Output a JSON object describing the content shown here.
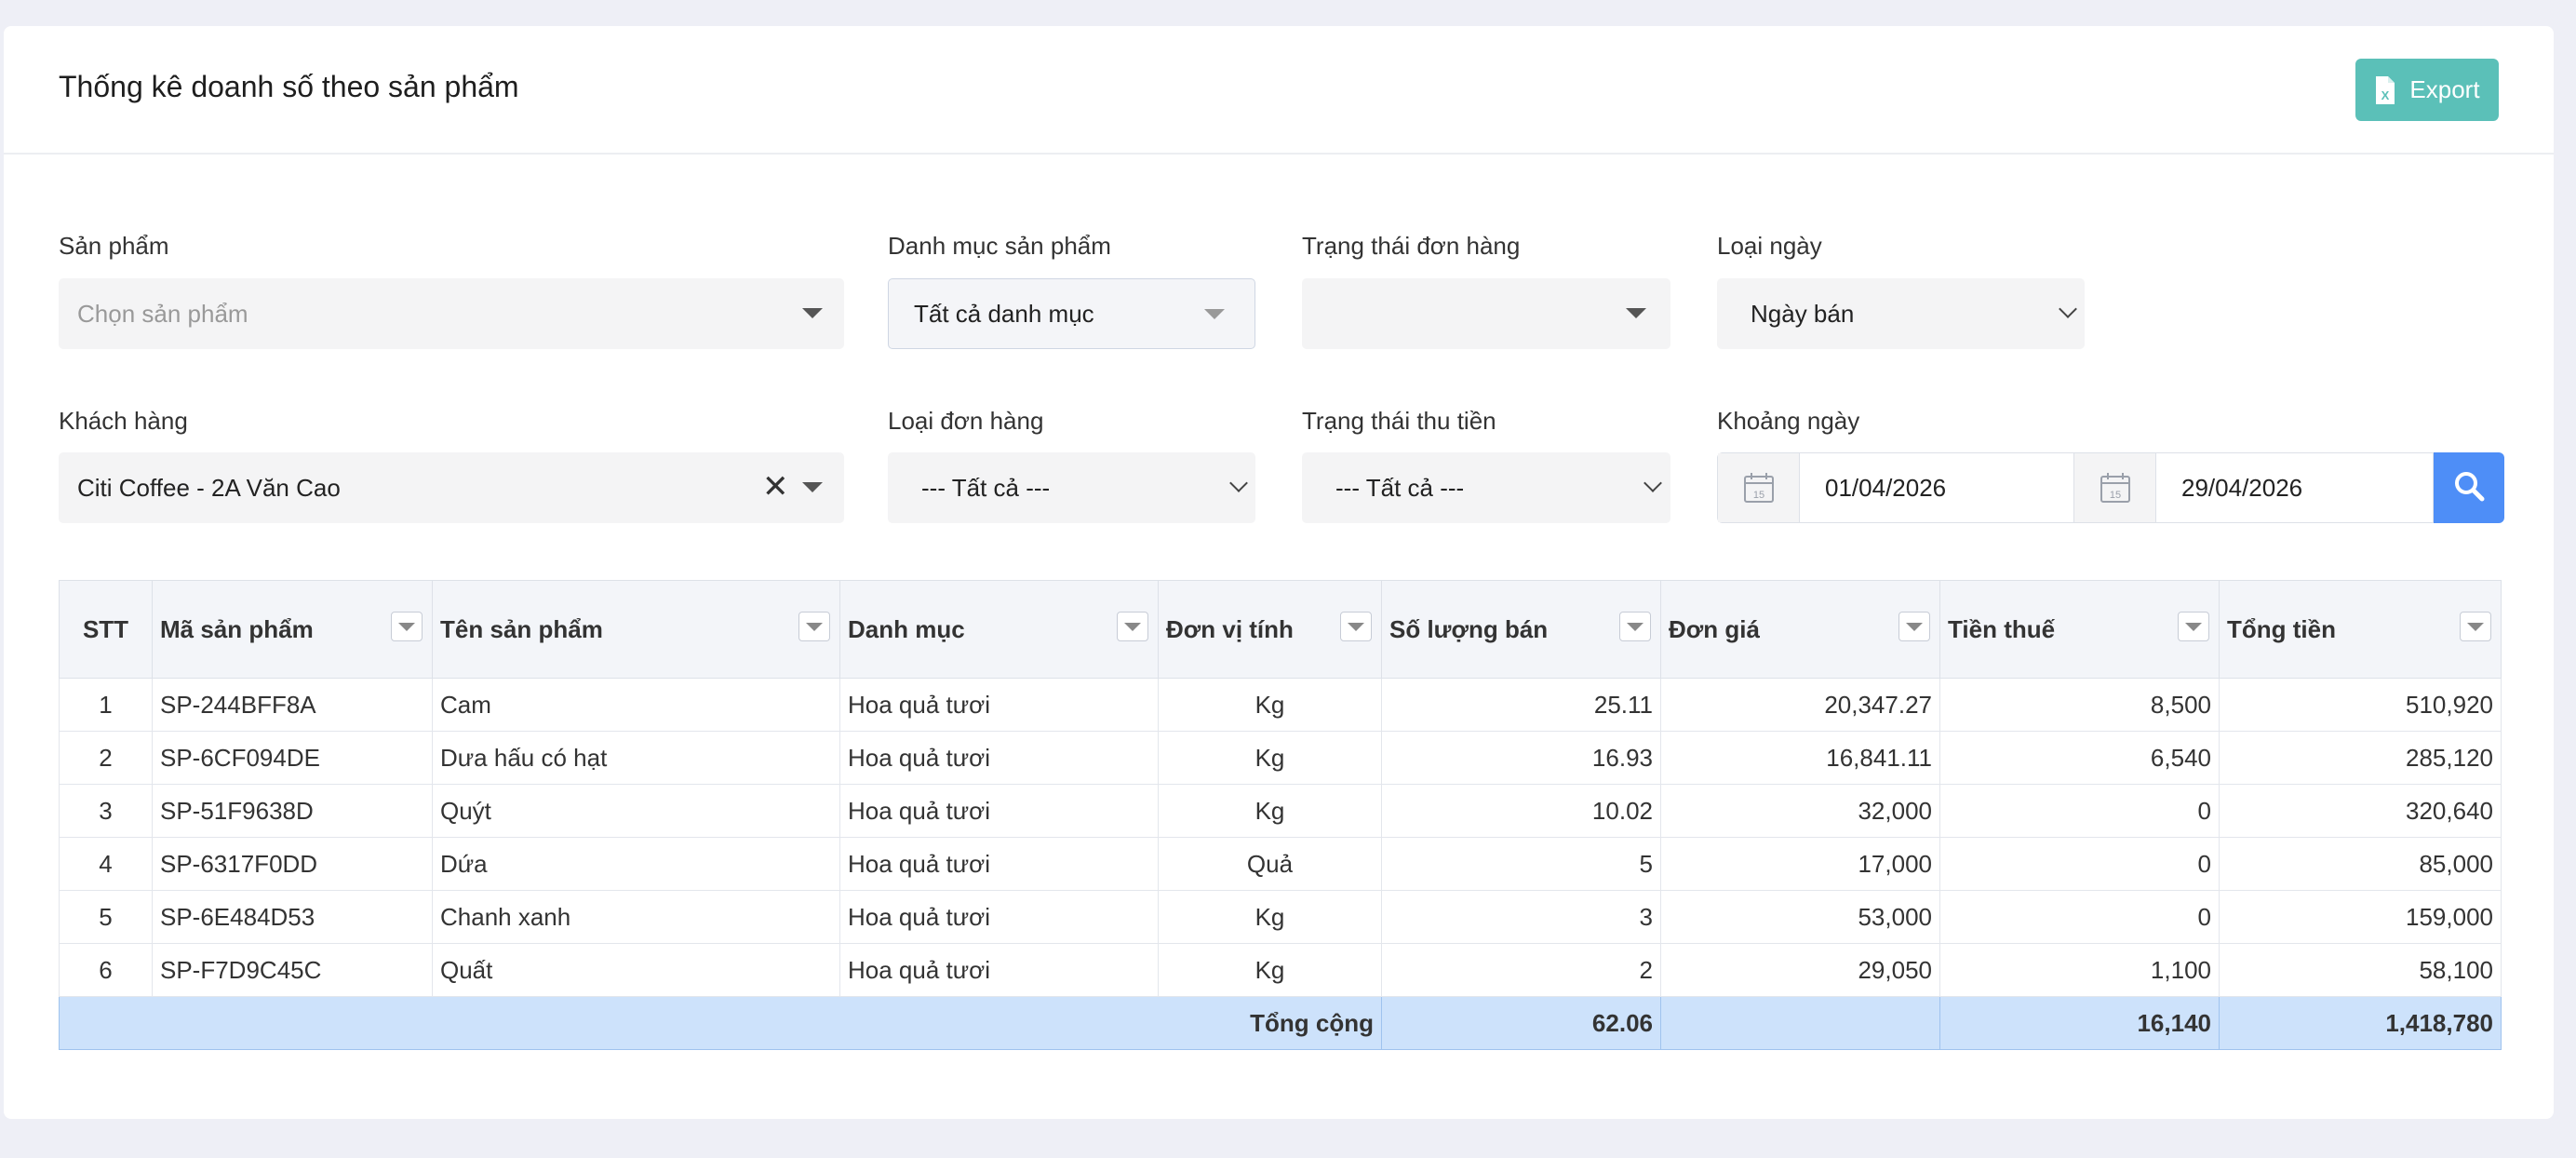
{
  "page": {
    "title": "Thống kê doanh số theo sản phẩm",
    "export_label": "Export"
  },
  "filters": {
    "product": {
      "label": "Sản phẩm",
      "placeholder": "Chọn sản phẩm"
    },
    "category": {
      "label": "Danh mục sản phẩm",
      "value": "Tất cả danh mục"
    },
    "order_status": {
      "label": "Trạng thái đơn hàng",
      "value": ""
    },
    "date_type": {
      "label": "Loại ngày",
      "value": "Ngày bán"
    },
    "customer": {
      "label": "Khách hàng",
      "value": "Citi Coffee - 2A Văn Cao"
    },
    "order_type": {
      "label": "Loại đơn hàng",
      "value": "--- Tất cả ---"
    },
    "payment_status": {
      "label": "Trạng thái thu tiền",
      "value": "--- Tất cả ---"
    },
    "date_range": {
      "label": "Khoảng ngày",
      "from": "01/04/2026",
      "to": "29/04/2026",
      "calendar_day": "15"
    }
  },
  "table": {
    "headers": [
      "STT",
      "Mã sản phẩm",
      "Tên sản phẩm",
      "Danh mục",
      "Đơn vị tính",
      "Số lượng bán",
      "Đơn giá",
      "Tiền thuế",
      "Tổng tiền"
    ],
    "rows": [
      [
        "1",
        "SP-244BFF8A",
        "Cam",
        "Hoa quả tươi",
        "Kg",
        "25.11",
        "20,347.27",
        "8,500",
        "510,920"
      ],
      [
        "2",
        "SP-6CF094DE",
        "Dưa hấu có hạt",
        "Hoa quả tươi",
        "Kg",
        "16.93",
        "16,841.11",
        "6,540",
        "285,120"
      ],
      [
        "3",
        "SP-51F9638D",
        "Quýt",
        "Hoa quả tươi",
        "Kg",
        "10.02",
        "32,000",
        "0",
        "320,640"
      ],
      [
        "4",
        "SP-6317F0DD",
        "Dứa",
        "Hoa quả tươi",
        "Quả",
        "5",
        "17,000",
        "0",
        "85,000"
      ],
      [
        "5",
        "SP-6E484D53",
        "Chanh xanh",
        "Hoa quả tươi",
        "Kg",
        "3",
        "53,000",
        "0",
        "159,000"
      ],
      [
        "6",
        "SP-F7D9C45C",
        "Quất",
        "Hoa quả tươi",
        "Kg",
        "2",
        "29,050",
        "1,100",
        "58,100"
      ]
    ],
    "total": {
      "label": "Tổng cộng",
      "quantity": "62.06",
      "tax": "16,140",
      "amount": "1,418,780"
    }
  },
  "colors": {
    "export": "#5bc0b8",
    "search": "#4e8ef7",
    "link": "#3e8ae8",
    "total_row": "#cde2fb"
  },
  "icons": [
    "excel-icon",
    "chevron-down-icon",
    "close-icon",
    "calendar-icon",
    "search-icon",
    "filter-icon"
  ]
}
